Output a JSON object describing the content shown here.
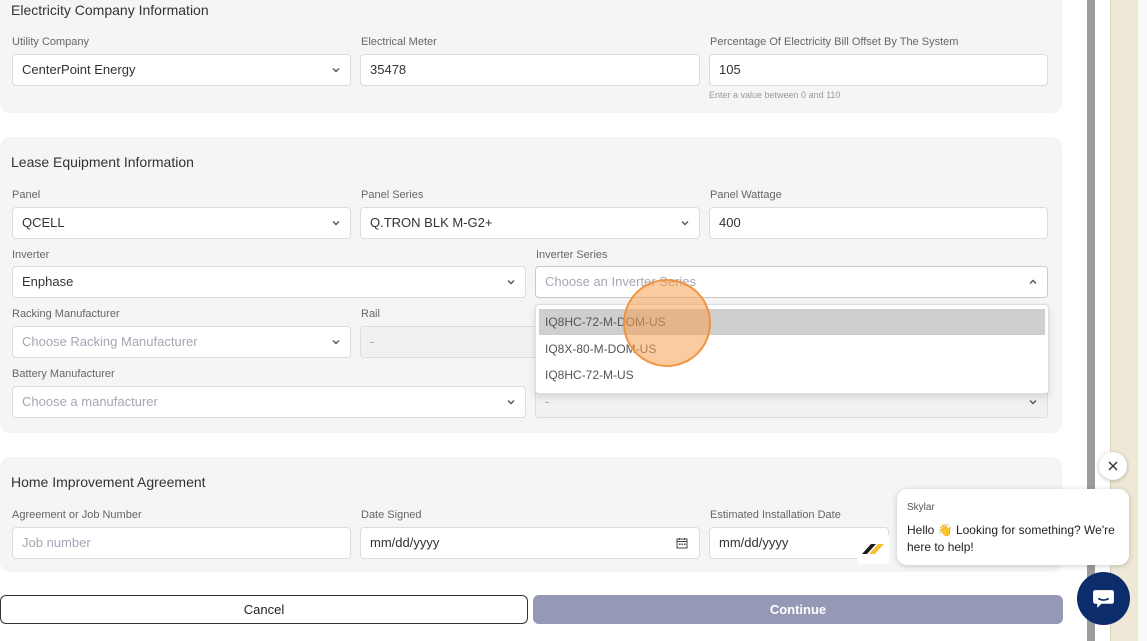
{
  "electricity": {
    "title": "Electricity Company Information",
    "utility_label": "Utility Company",
    "utility_value": "CenterPoint Energy",
    "meter_label": "Electrical Meter",
    "meter_value": "35478",
    "offset_label": "Percentage Of Electricity Bill Offset By The System",
    "offset_value": "105",
    "offset_hint": "Enter a value between 0 and 110"
  },
  "lease": {
    "title": "Lease Equipment Information",
    "panel_label": "Panel",
    "panel_value": "QCELL",
    "panel_series_label": "Panel Series",
    "panel_series_value": "Q.TRON BLK M-G2+",
    "wattage_label": "Panel Wattage",
    "wattage_value": "400",
    "inverter_label": "Inverter",
    "inverter_value": "Enphase",
    "inverter_series_label": "Inverter Series",
    "inverter_series_placeholder": "Choose an Inverter Series",
    "inverter_series_options": [
      "IQ8HC-72-M-DOM-US",
      "IQ8X-80-M-DOM-US",
      "IQ8HC-72-M-US"
    ],
    "racking_label": "Racking Manufacturer",
    "racking_placeholder": "Choose Racking Manufacturer",
    "rail_label": "Rail",
    "rail_value": "-",
    "battery_label": "Battery Manufacturer",
    "battery_placeholder": "Choose a manufacturer",
    "battery_model_value": "-"
  },
  "home": {
    "title": "Home Improvement Agreement",
    "agreement_label": "Agreement or Job Number",
    "agreement_placeholder": "Job number",
    "date_signed_label": "Date Signed",
    "date_signed_value": "mm/dd/yyyy",
    "install_label": "Estimated Installation Date",
    "install_value": "mm/dd/yyyy"
  },
  "actions": {
    "cancel": "Cancel",
    "continue": "Continue"
  },
  "chat": {
    "sender": "Skylar",
    "message": "Hello 👋 Looking for something? We're here to help!",
    "close_icon": "close-icon",
    "chat_icon": "chat-bubble-icon"
  },
  "colors": {
    "card_bg": "#f5f5f5",
    "continue_bg": "#9599b6",
    "chat_button": "#0d2c6b",
    "cursor": "#f5a050"
  }
}
